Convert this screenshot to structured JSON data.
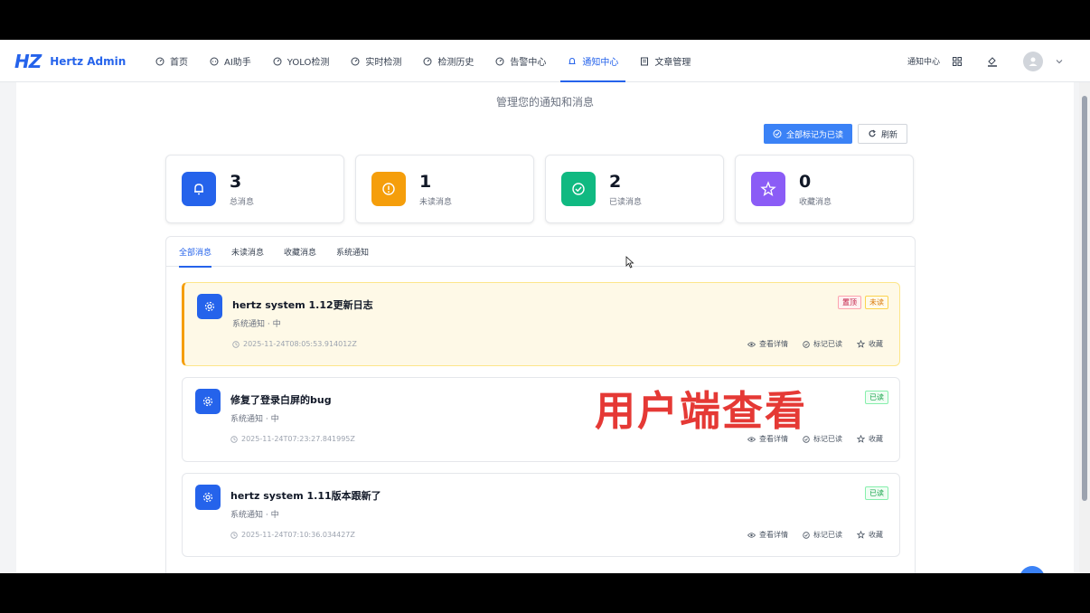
{
  "app": {
    "logo_mark": "HZ",
    "title": "Hertz Admin"
  },
  "nav": [
    {
      "label": "首页",
      "icon": "dashboard-icon"
    },
    {
      "label": "AI助手",
      "icon": "chat-icon"
    },
    {
      "label": "YOLO检测",
      "icon": "dashboard-icon"
    },
    {
      "label": "实时检测",
      "icon": "dashboard-icon"
    },
    {
      "label": "检测历史",
      "icon": "dashboard-icon"
    },
    {
      "label": "告警中心",
      "icon": "dashboard-icon"
    },
    {
      "label": "通知中心",
      "icon": "bell-icon",
      "active": true
    },
    {
      "label": "文章管理",
      "icon": "document-icon"
    }
  ],
  "header_right": {
    "breadcrumb": "通知中心"
  },
  "page": {
    "subtitle": "管理您的通知和消息",
    "mark_all_read": "全部标记为已读",
    "refresh": "刷新"
  },
  "stats": [
    {
      "value": "3",
      "label": "总消息",
      "color": "#2563eb"
    },
    {
      "value": "1",
      "label": "未读消息",
      "color": "#f59e0b"
    },
    {
      "value": "2",
      "label": "已读消息",
      "color": "#10b981"
    },
    {
      "value": "0",
      "label": "收藏消息",
      "color": "#8b5cf6"
    }
  ],
  "tabs": [
    "全部消息",
    "未读消息",
    "收藏消息",
    "系统通知"
  ],
  "notices": [
    {
      "title": "hertz system 1.12更新日志",
      "meta": "系统通知 · 中",
      "time": "2025-11-24T08:05:53.914012Z",
      "tags": [
        "置顶",
        "未读"
      ]
    },
    {
      "title": "修复了登录白屏的bug",
      "meta": "系统通知 · 中",
      "time": "2025-11-24T07:23:27.841995Z",
      "tags": [
        "已读"
      ]
    },
    {
      "title": "hertz system 1.11版本跟新了",
      "meta": "系统通知 · 中",
      "time": "2025-11-24T07:10:36.034427Z",
      "tags": [
        "已读"
      ]
    }
  ],
  "notice_actions": {
    "view": "查看详情",
    "mark": "标记已读",
    "favorite": "收藏"
  },
  "overlay_caption": "用户端查看"
}
